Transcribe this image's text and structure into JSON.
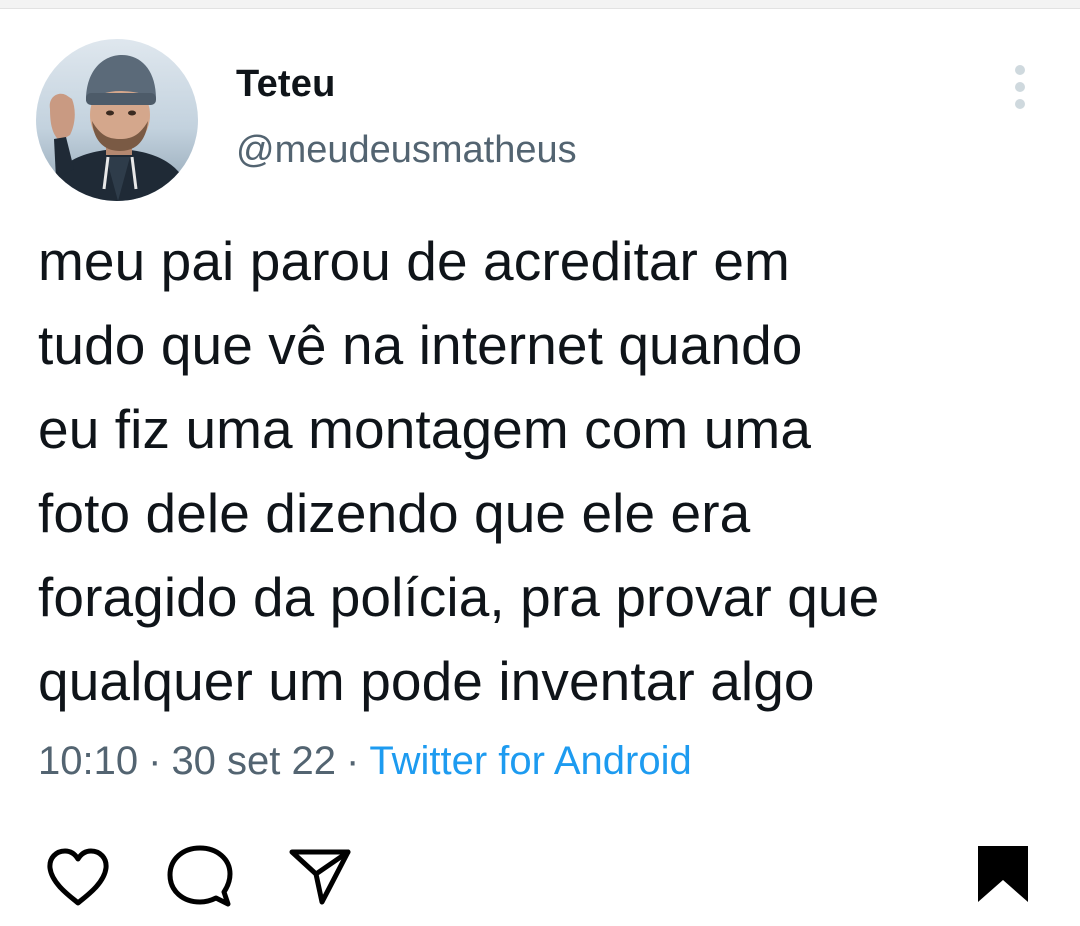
{
  "tweet": {
    "author": {
      "display_name": "Teteu",
      "handle": "@meudeusmatheus"
    },
    "text": "meu pai parou de acreditar em\ntudo que vê na internet quando\neu fiz uma montagem com uma\nfoto dele dizendo que ele era\nforagido da polícia, pra provar que\nqualquer um pode inventar algo",
    "time": "10:10",
    "separator": "·",
    "date": "30 set 22",
    "source": "Twitter for Android",
    "more_icon": "more-vertical-icon"
  },
  "actions": {
    "icons": [
      "heart-icon",
      "comment-icon",
      "share-icon",
      "bookmark-icon"
    ]
  },
  "colors": {
    "text_primary": "#0f1419",
    "text_secondary": "#536471",
    "link": "#1d9bf0",
    "icon": "#000000"
  }
}
